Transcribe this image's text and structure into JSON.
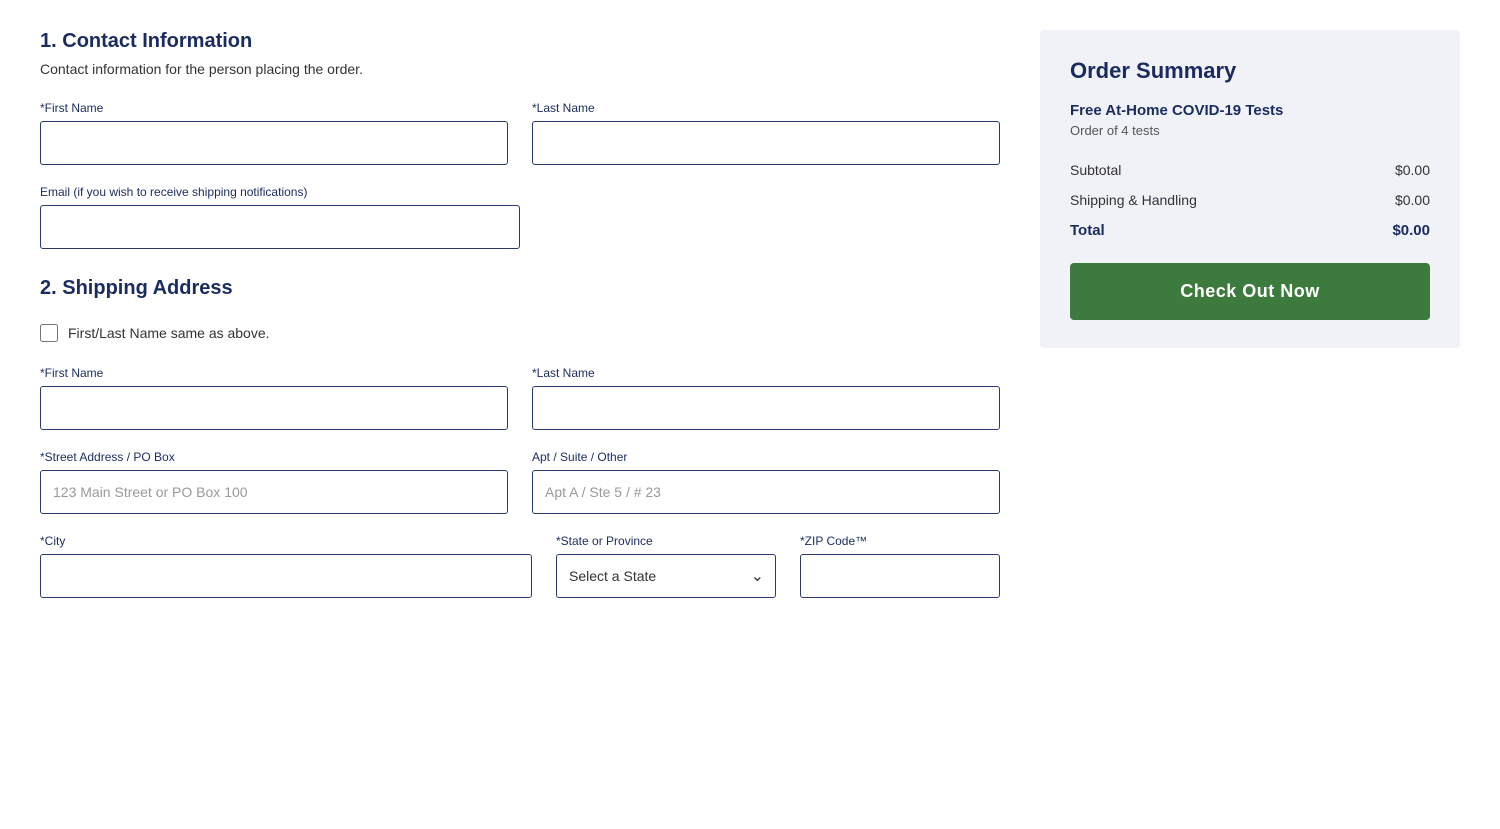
{
  "contact": {
    "section_number": "1.",
    "section_title": "Contact Information",
    "section_subtitle": "Contact information for the person placing the order.",
    "first_name_label": "*First Name",
    "last_name_label": "*Last Name",
    "email_label": "Email (if you wish to receive shipping notifications)"
  },
  "shipping": {
    "section_number": "2.",
    "section_title": "Shipping Address",
    "checkbox_label": "First/Last Name same as above.",
    "first_name_label": "*First Name",
    "last_name_label": "*Last Name",
    "street_label": "*Street Address / PO Box",
    "street_placeholder": "123 Main Street or PO Box 100",
    "apt_label": "Apt / Suite / Other",
    "apt_placeholder": "Apt A / Ste 5 / # 23",
    "city_label": "*City",
    "state_label": "*State or Province",
    "state_placeholder": "Select a State",
    "zip_label": "*ZIP Code™"
  },
  "order_summary": {
    "title": "Order Summary",
    "product_name": "Free At-Home COVID-19 Tests",
    "product_subtitle": "Order of 4 tests",
    "subtotal_label": "Subtotal",
    "subtotal_value": "$0.00",
    "shipping_label": "Shipping & Handling",
    "shipping_value": "$0.00",
    "total_label": "Total",
    "total_value": "$0.00",
    "checkout_button_label": "Check Out Now"
  }
}
